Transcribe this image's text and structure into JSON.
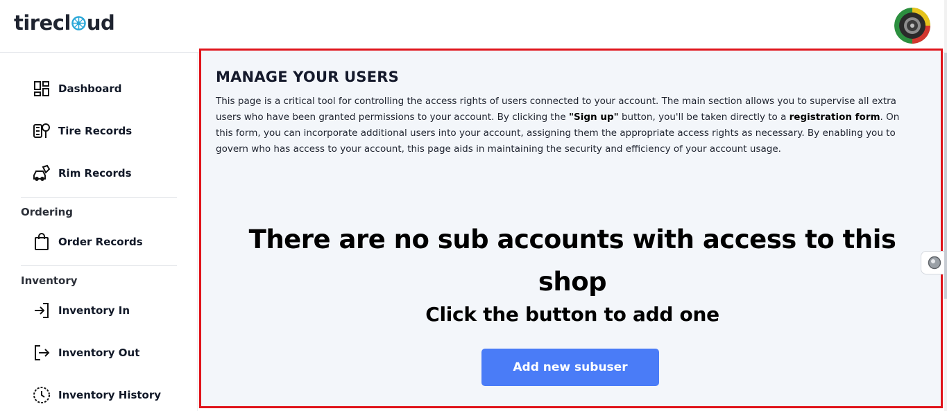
{
  "app": {
    "logo_part1": "tirecl",
    "logo_part2": "ud"
  },
  "sidebar": {
    "items": [
      {
        "label": "Dashboard",
        "icon": "dashboard-icon"
      },
      {
        "label": "Tire Records",
        "icon": "tire-records-icon"
      },
      {
        "label": "Rim Records",
        "icon": "rim-records-icon"
      }
    ],
    "ordering": {
      "title": "Ordering",
      "items": [
        {
          "label": "Order Records",
          "icon": "shopping-bag-icon"
        }
      ]
    },
    "inventory": {
      "title": "Inventory",
      "items": [
        {
          "label": "Inventory In",
          "icon": "login-arrow-icon"
        },
        {
          "label": "Inventory Out",
          "icon": "logout-arrow-icon"
        },
        {
          "label": "Inventory History",
          "icon": "history-clock-icon"
        }
      ]
    }
  },
  "main": {
    "title": "MANAGE YOUR USERS",
    "description": {
      "p1": "This page is a critical tool for controlling the access rights of users connected to your account. The main section allows you to supervise all extra users who have been granted permissions to your account. By clicking the ",
      "b1": "\"Sign up\"",
      "p2": " button, you'll be taken directly to a ",
      "b2": "registration form",
      "p3": ". On this form, you can incorporate additional users into your account, assigning them the appropriate access rights as necessary. By enabling you to govern who has access to your account, this page aids in maintaining the security and efficiency of your account usage."
    },
    "empty_title": "There are no sub accounts with access to this shop",
    "empty_subtitle": "Click the button to add one",
    "add_button_label": "Add new subuser"
  },
  "colors": {
    "accent": "#4a7cf7",
    "highlight_border": "#e0141b",
    "panel_bg": "#f3f6fa"
  }
}
